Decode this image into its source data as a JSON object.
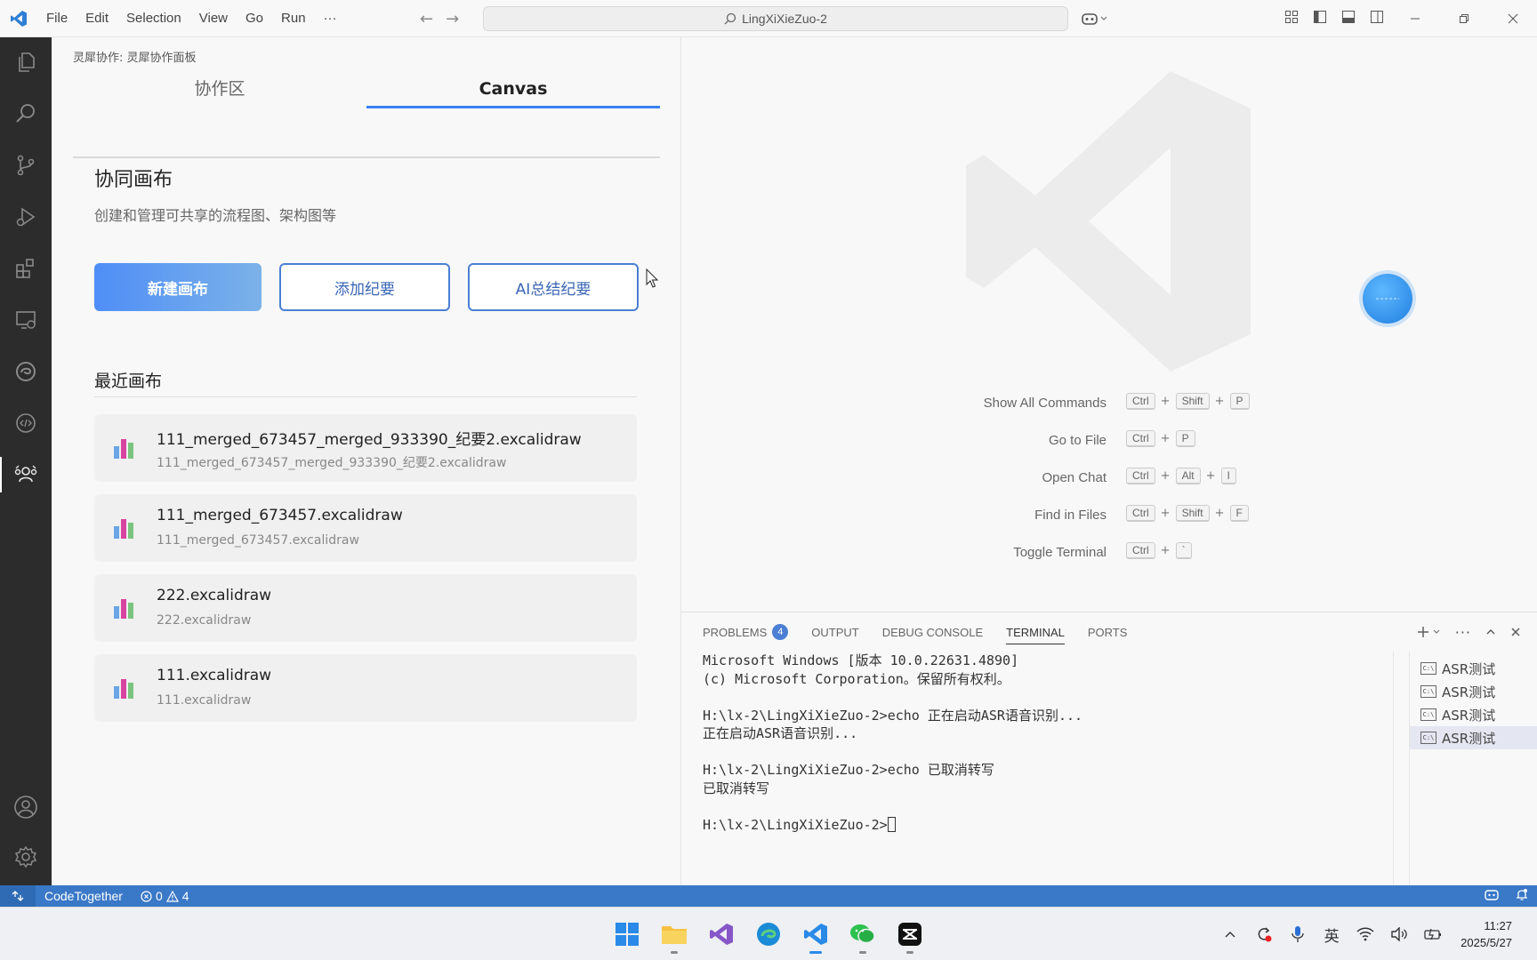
{
  "titlebar": {
    "menu": [
      "File",
      "Edit",
      "Selection",
      "View",
      "Go",
      "Run",
      "···"
    ],
    "search_text": "LingXiXieZuo-2"
  },
  "sidebar": {
    "title": "灵犀协作: 灵犀协作面板",
    "tabs": [
      {
        "label": "协作区",
        "active": false
      },
      {
        "label": "Canvas",
        "active": true
      }
    ],
    "section_title": "协同画布",
    "section_desc": "创建和管理可共享的流程图、架构图等",
    "buttons": {
      "new_canvas": "新建画布",
      "add_minutes": "添加纪要",
      "ai_summary": "AI总结纪要"
    },
    "recent_title": "最近画布",
    "recent_files": [
      {
        "name": "111_merged_673457_merged_933390_纪要2.excalidraw",
        "path": "111_merged_673457_merged_933390_纪要2.excalidraw"
      },
      {
        "name": "111_merged_673457.excalidraw",
        "path": "111_merged_673457.excalidraw"
      },
      {
        "name": "222.excalidraw",
        "path": "222.excalidraw"
      },
      {
        "name": "111.excalidraw",
        "path": "111.excalidraw"
      }
    ]
  },
  "editor": {
    "shortcuts": [
      {
        "label": "Show All Commands",
        "keys": [
          "Ctrl",
          "Shift",
          "P"
        ]
      },
      {
        "label": "Go to File",
        "keys": [
          "Ctrl",
          "P"
        ]
      },
      {
        "label": "Open Chat",
        "keys": [
          "Ctrl",
          "Alt",
          "I"
        ]
      },
      {
        "label": "Find in Files",
        "keys": [
          "Ctrl",
          "Shift",
          "F"
        ]
      },
      {
        "label": "Toggle Terminal",
        "keys": [
          "Ctrl",
          "`"
        ]
      }
    ]
  },
  "panel": {
    "tabs": [
      {
        "label": "PROBLEMS",
        "badge": "4"
      },
      {
        "label": "OUTPUT"
      },
      {
        "label": "DEBUG CONSOLE"
      },
      {
        "label": "TERMINAL",
        "active": true
      },
      {
        "label": "PORTS"
      }
    ],
    "terminal_lines": [
      "Microsoft Windows [版本 10.0.22631.4890]",
      "(c) Microsoft Corporation。保留所有权利。",
      "",
      "H:\\lx-2\\LingXiXieZuo-2>echo 正在启动ASR语音识别...",
      "正在启动ASR语音识别...",
      "",
      "H:\\lx-2\\LingXiXieZuo-2>echo 已取消转写",
      "已取消转写",
      ""
    ],
    "prompt": "H:\\lx-2\\LingXiXieZuo-2>",
    "terminals": [
      "ASR测试",
      "ASR测试",
      "ASR测试",
      "ASR测试"
    ]
  },
  "statusbar": {
    "extension": "CodeTogether",
    "errors": "0",
    "warnings": "4"
  },
  "taskbar": {
    "ime": "英",
    "time": "11:27",
    "date": "2025/5/27"
  },
  "colors": {
    "accent": "#3a78c8",
    "primary_button": "#4f8ef7",
    "activity_bar": "#2c2c2c"
  }
}
